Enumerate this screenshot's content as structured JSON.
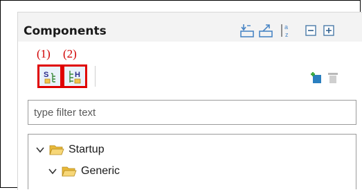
{
  "panel": {
    "title": "Components",
    "header_icons": [
      "import-icon",
      "export-icon",
      "sort-alpha-icon",
      "collapse-all-icon",
      "expand-all-icon"
    ]
  },
  "annotations": {
    "one": "(1)",
    "two": "(2)"
  },
  "toolbar": {
    "buttons": [
      {
        "icon": "component-view-icon"
      },
      {
        "icon": "hardware-view-icon"
      }
    ],
    "right_icons": [
      "add-component-icon",
      "remove-component-icon"
    ]
  },
  "filter": {
    "placeholder": "type filter text",
    "value": ""
  },
  "tree": {
    "items": [
      {
        "label": "Startup",
        "icon": "folder-open-icon",
        "expanded": true
      },
      {
        "label": "Generic",
        "icon": "folder-open-icon",
        "expanded": true
      }
    ]
  },
  "colors": {
    "highlight": "#e00000",
    "folder": "#f2c54a",
    "header_bg": "#f3f3f3"
  }
}
